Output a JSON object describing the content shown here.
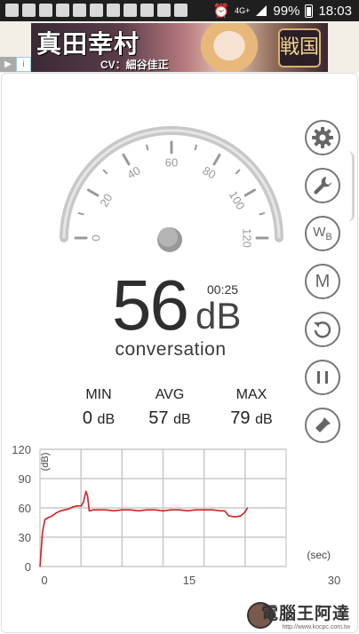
{
  "status_bar": {
    "network": "4G+",
    "battery": "99%",
    "time": "18:03"
  },
  "ad": {
    "title": "真田幸村",
    "subtitle": "CV：細谷佳正",
    "logo_text": "戦国",
    "info_label": "i"
  },
  "gauge": {
    "ticks": [
      "0",
      "20",
      "40",
      "60",
      "80",
      "100",
      "120"
    ],
    "current_value": 56,
    "min": 0,
    "max": 120
  },
  "readout": {
    "value": "56",
    "unit": "dB",
    "timer": "00:25",
    "status": "conversation"
  },
  "stats": [
    {
      "label": "MIN",
      "value": "0",
      "unit": "dB"
    },
    {
      "label": "AVG",
      "value": "57",
      "unit": "dB"
    },
    {
      "label": "MAX",
      "value": "79",
      "unit": "dB"
    }
  ],
  "sidebar": {
    "buttons": [
      {
        "icon": "gear-icon"
      },
      {
        "icon": "wrench-icon"
      },
      {
        "icon": "white-balance-icon",
        "label": "W",
        "sub": "B"
      },
      {
        "icon": "m-icon",
        "label": "M"
      },
      {
        "icon": "reset-icon"
      },
      {
        "icon": "pause-icon"
      },
      {
        "icon": "flashlight-icon"
      }
    ]
  },
  "chart_data": {
    "type": "line",
    "ylabel": "(dB)",
    "xlabel": "(sec)",
    "ylim": [
      0,
      120
    ],
    "xlim": [
      0,
      30
    ],
    "y_ticks": [
      "0",
      "30",
      "60",
      "90",
      "120"
    ],
    "x_ticks": [
      "0",
      "15",
      "30"
    ],
    "grid": true,
    "color": "#d42020",
    "series": [
      {
        "x": [
          0,
          0.3,
          0.6,
          1.0,
          1.5,
          2,
          2.5,
          3,
          3.5,
          4,
          4.5,
          5,
          5.3,
          5.6,
          5.8,
          6,
          6.5,
          7,
          8,
          9,
          10,
          11,
          12,
          13,
          14,
          15,
          16,
          17,
          18,
          19,
          20,
          21,
          22,
          22.5,
          23,
          23.5,
          24,
          24.5,
          25,
          25.3
        ],
        "y": [
          0,
          35,
          48,
          50,
          52,
          55,
          57,
          58,
          59,
          61,
          62,
          62,
          66,
          77,
          72,
          57,
          58,
          58,
          58,
          57,
          58,
          58,
          57,
          58,
          58,
          57,
          58,
          58,
          57,
          58,
          58,
          58,
          57,
          57,
          52,
          51,
          51,
          52,
          56,
          60
        ]
      }
    ]
  },
  "watermark": {
    "text": "電腦王阿達",
    "url": "http://www.kocpc.com.tw"
  }
}
